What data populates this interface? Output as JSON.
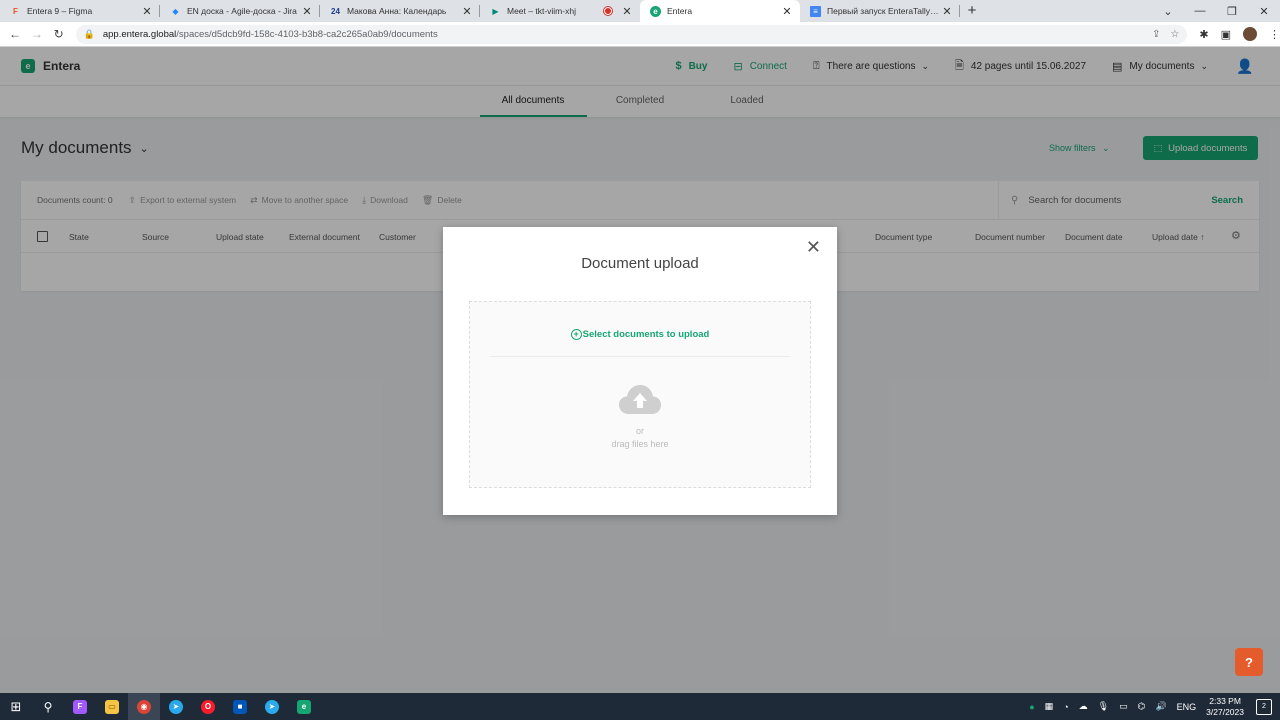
{
  "browser": {
    "tabs": [
      {
        "title": "Entera 9 – Figma",
        "favicon": "figma-icon",
        "color": "#f24e1e"
      },
      {
        "title": "EN доска - Agile-доска - Jira",
        "favicon": "jira-icon",
        "color": "#2684ff"
      },
      {
        "title": "Макова Анна: Календарь",
        "favicon": "calendar-24-icon",
        "color": "#1a3c8c"
      },
      {
        "title": "Meet – tkt-viim-xhj",
        "favicon": "meet-icon",
        "color": "#00897b"
      },
      {
        "title": "Entera",
        "favicon": "entera-icon",
        "color": "#17a673"
      },
      {
        "title": "Первый запуск EnteraTallyConne",
        "favicon": "docs-icon",
        "color": "#4285f4"
      }
    ],
    "address": {
      "host": "app.entera.global",
      "path": "/spaces/d5dcb9fd-158c-4103-b3b8-ca2c265a0ab9/documents"
    }
  },
  "header": {
    "brand": "Entera",
    "buy": "Buy",
    "connect": "Connect",
    "questions": "There are questions",
    "pages": "42 pages until 15.06.2027",
    "my_documents": "My documents"
  },
  "tabs": {
    "all": "All documents",
    "completed": "Completed",
    "loaded": "Loaded"
  },
  "page": {
    "title": "My documents",
    "show_filters": "Show filters",
    "upload_button": "Upload documents"
  },
  "toolbar": {
    "count": "Documents count: 0",
    "export": "Export to external system",
    "move": "Move to another space",
    "download": "Download",
    "delete": "Delete",
    "search_placeholder": "Search for documents",
    "search_button": "Search"
  },
  "columns": {
    "state": "State",
    "source": "Source",
    "upload_state": "Upload state",
    "external_document": "External document",
    "customer": "Customer",
    "document_type": "Document type",
    "document_number": "Document number",
    "document_date": "Document date",
    "upload_date": "Upload date"
  },
  "modal": {
    "title": "Document upload",
    "select": "Select documents to upload",
    "or": "or",
    "drag": "drag files here"
  },
  "help": "?",
  "taskbar": {
    "lang": "ENG",
    "time": "2:33 PM",
    "date": "3/27/2023",
    "notifications": "2"
  },
  "colors": {
    "accent": "#17a673",
    "help": "#e45c2c"
  }
}
